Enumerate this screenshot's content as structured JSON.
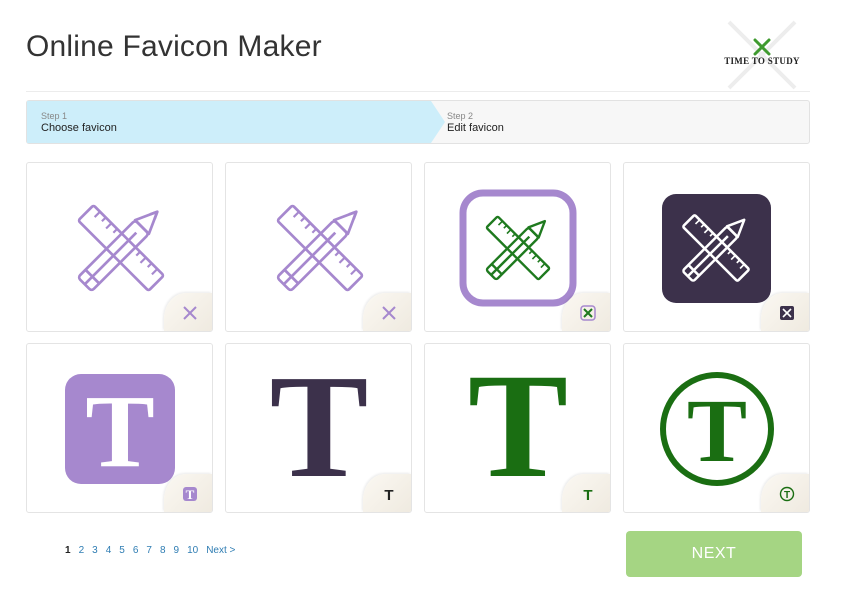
{
  "header": {
    "title": "Online Favicon Maker",
    "logo_text": "Time to Study"
  },
  "steps": [
    {
      "number": "Step 1",
      "label": "Choose favicon",
      "active": true
    },
    {
      "number": "Step 2",
      "label": "Edit favicon",
      "active": false
    }
  ],
  "favicons": [
    {
      "name": "pencil-ruler-outline",
      "color": "#a688ce"
    },
    {
      "name": "pencil-ruler-outline-alt",
      "color": "#a688ce"
    },
    {
      "name": "pencil-ruler-framed",
      "color": "#1f7a1f",
      "frame": "#a688ce"
    },
    {
      "name": "pencil-ruler-dark-tile",
      "color": "#ffffff",
      "frame": "#3c314b"
    },
    {
      "name": "letter-t-purple-tile",
      "letter": "T",
      "color": "#ffffff",
      "frame": "#a688ce"
    },
    {
      "name": "letter-t-dark",
      "letter": "T",
      "color": "#3c314b"
    },
    {
      "name": "letter-t-green",
      "letter": "T",
      "color": "#1a6e12"
    },
    {
      "name": "letter-t-green-circle",
      "letter": "T",
      "color": "#1a6e12"
    }
  ],
  "pagination": {
    "pages": [
      "1",
      "2",
      "3",
      "4",
      "5",
      "6",
      "7",
      "8",
      "9",
      "10"
    ],
    "current": "1",
    "next_label": "Next >"
  },
  "actions": {
    "next_label": "NEXT"
  },
  "colors": {
    "accent_step": "#cdeefa",
    "button": "#a5d583",
    "purple": "#a688ce",
    "dark": "#3c314b",
    "green": "#1a6e12",
    "link": "#2f7db3"
  }
}
